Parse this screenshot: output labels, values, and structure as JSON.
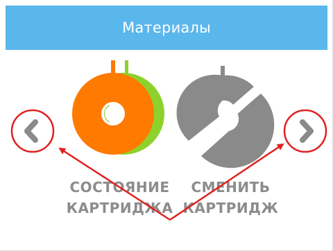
{
  "header": {
    "title": "Материалы"
  },
  "tiles": [
    {
      "line1": "СОСТОЯНИЕ",
      "line2": "КАРТРИДЖА",
      "icon": "spool-icon"
    },
    {
      "line1": "СМЕНИТЬ",
      "line2": "КАРТРИДЖ",
      "icon": "swap-spool-icon"
    }
  ],
  "navigation": {
    "prev_icon": "chevron-left-icon",
    "next_icon": "chevron-right-icon"
  },
  "colors": {
    "header_bg": "#5ab7ec",
    "header_text": "#ffffff",
    "spool_orange": "#ff7a00",
    "spool_green": "#8fd12c",
    "gray_icon": "#8a8a8a",
    "label_gray": "#8c8c8c",
    "annotation_red": "#e02020"
  }
}
